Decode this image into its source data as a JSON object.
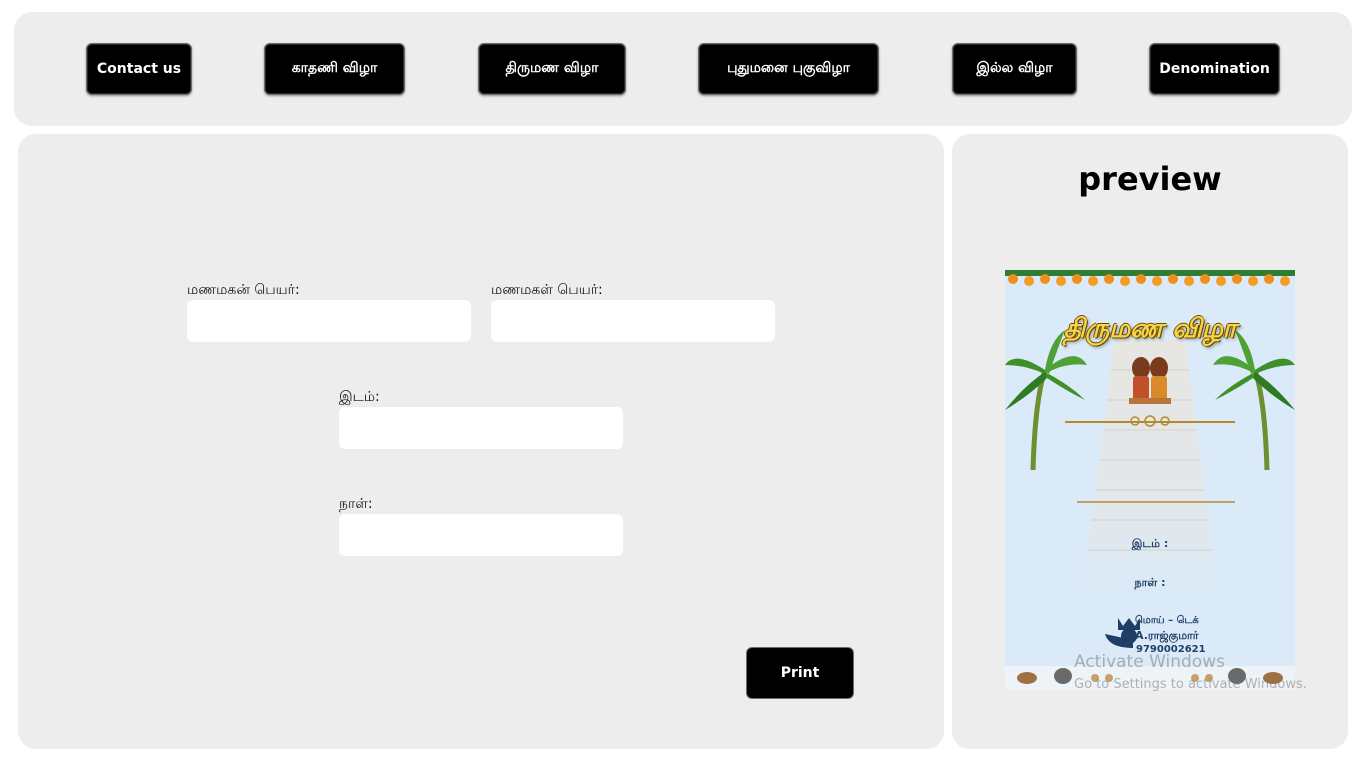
{
  "nav": {
    "contact": "Contact us",
    "kathani": "காதணி விழா",
    "thirumana": "திருமண விழா",
    "puthumanai": "புதுமனை புகுவிழா",
    "illa": "இல்ல விழா",
    "denomination": "Denomination"
  },
  "form": {
    "groom_label": "மணமகன் பெயர்:",
    "bride_label": "மணமகள் பெயர்:",
    "place_label": "இடம்:",
    "date_label": "நாள்:",
    "groom_value": "",
    "bride_value": "",
    "place_value": "",
    "date_value": "",
    "print_label": "Print"
  },
  "preview": {
    "title": "preview",
    "card": {
      "heading": "திருமண விழா",
      "place": "இடம் :",
      "date": "நாள் :",
      "brand": "மொய் – டெக்",
      "owner": "A.ராஜ்குமார்",
      "phone": "9790002621"
    }
  },
  "watermark": {
    "title": "Activate Windows",
    "subtitle": "Go to Settings to activate Windows."
  },
  "colors": {
    "panel_bg": "#ededed",
    "button_bg": "#000000",
    "card_bg": "#dbeaf8",
    "card_text": "#1f3e66",
    "card_heading": "#f6d54a"
  }
}
